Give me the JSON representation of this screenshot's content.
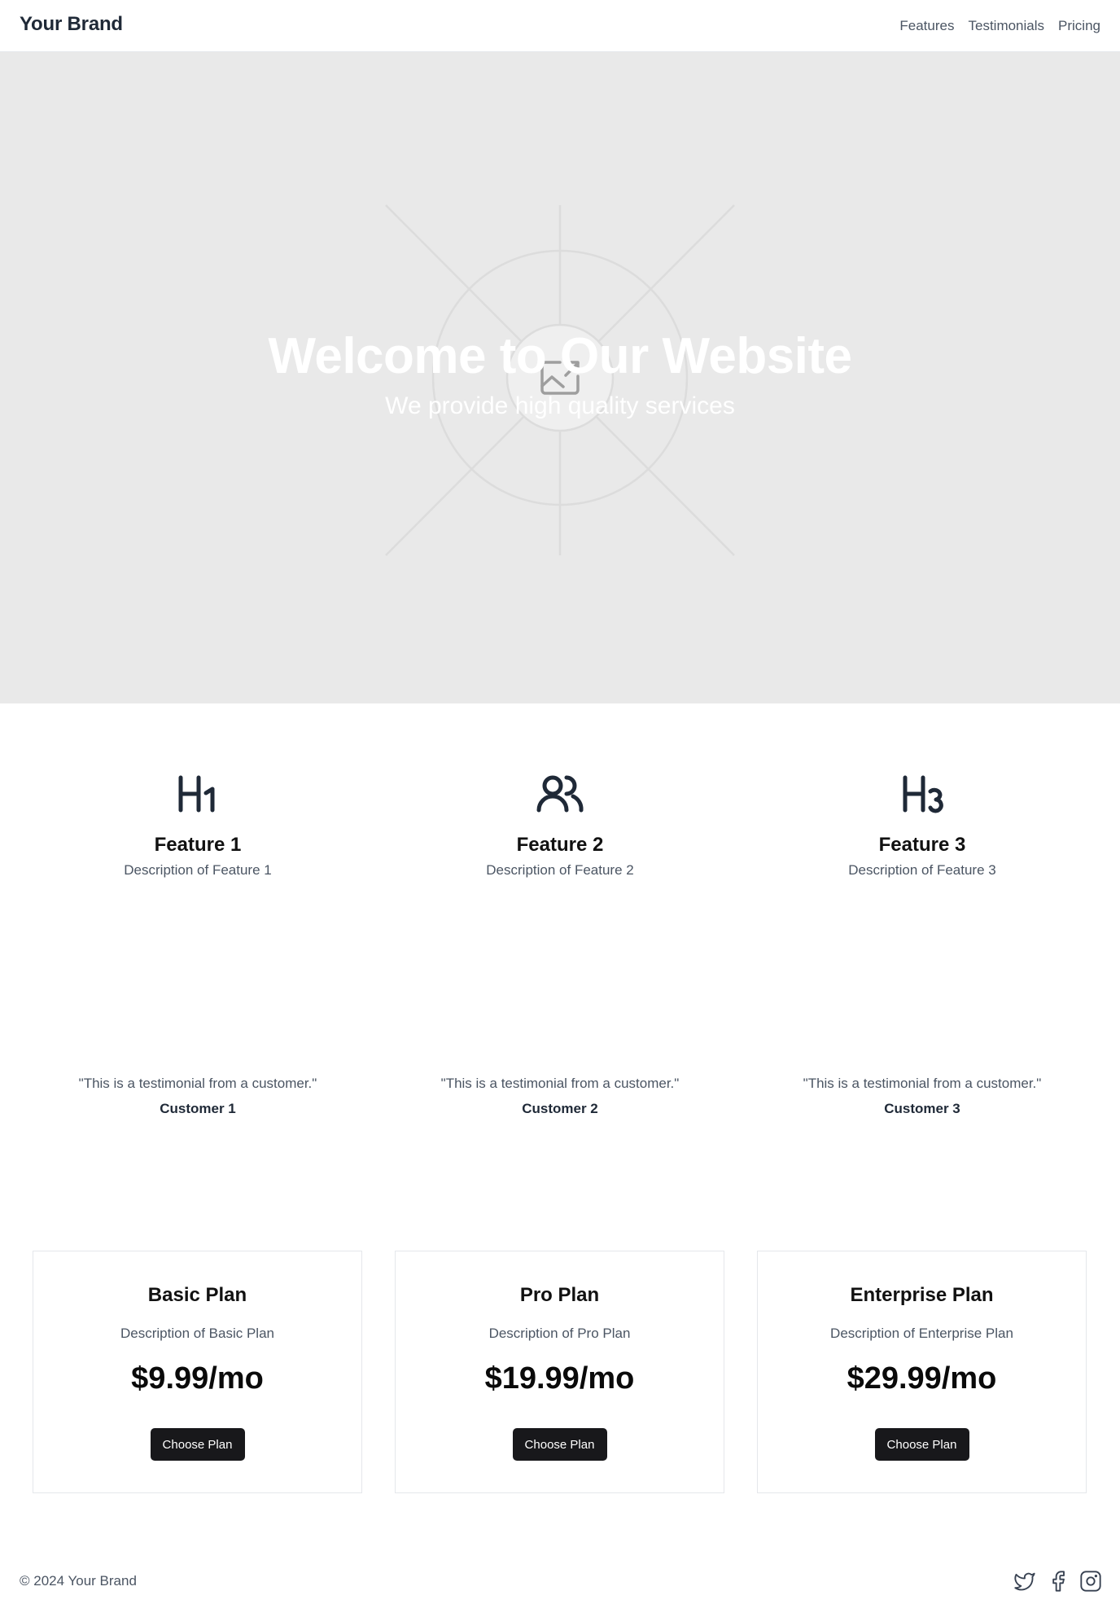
{
  "header": {
    "brand": "Your Brand",
    "nav": [
      "Features",
      "Testimonials",
      "Pricing"
    ]
  },
  "hero": {
    "title": "Welcome to Our Website",
    "subtitle": "We provide high quality services",
    "image_icon": "image-placeholder-icon"
  },
  "features": [
    {
      "icon": "heading-1-icon",
      "title": "Feature 1",
      "description": "Description of Feature 1"
    },
    {
      "icon": "users-icon",
      "title": "Feature 2",
      "description": "Description of Feature 2"
    },
    {
      "icon": "heading-3-icon",
      "title": "Feature 3",
      "description": "Description of Feature 3"
    }
  ],
  "testimonials": [
    {
      "quote": "\"This is a testimonial from a customer.\"",
      "customer": "Customer 1"
    },
    {
      "quote": "\"This is a testimonial from a customer.\"",
      "customer": "Customer 2"
    },
    {
      "quote": "\"This is a testimonial from a customer.\"",
      "customer": "Customer 3"
    }
  ],
  "pricing": [
    {
      "title": "Basic Plan",
      "description": "Description of Basic Plan",
      "price": "$9.99/mo",
      "button": "Choose Plan"
    },
    {
      "title": "Pro Plan",
      "description": "Description of Pro Plan",
      "price": "$19.99/mo",
      "button": "Choose Plan"
    },
    {
      "title": "Enterprise Plan",
      "description": "Description of Enterprise Plan",
      "price": "$29.99/mo",
      "button": "Choose Plan"
    }
  ],
  "footer": {
    "copyright": "© 2024 Your Brand",
    "social_icons": [
      "twitter-icon",
      "facebook-icon",
      "instagram-icon"
    ]
  },
  "colors": {
    "hero_bg": "#e9e9e9",
    "button_bg": "#18181b",
    "text_muted": "#4b5563",
    "text_dark": "#1f2937"
  }
}
